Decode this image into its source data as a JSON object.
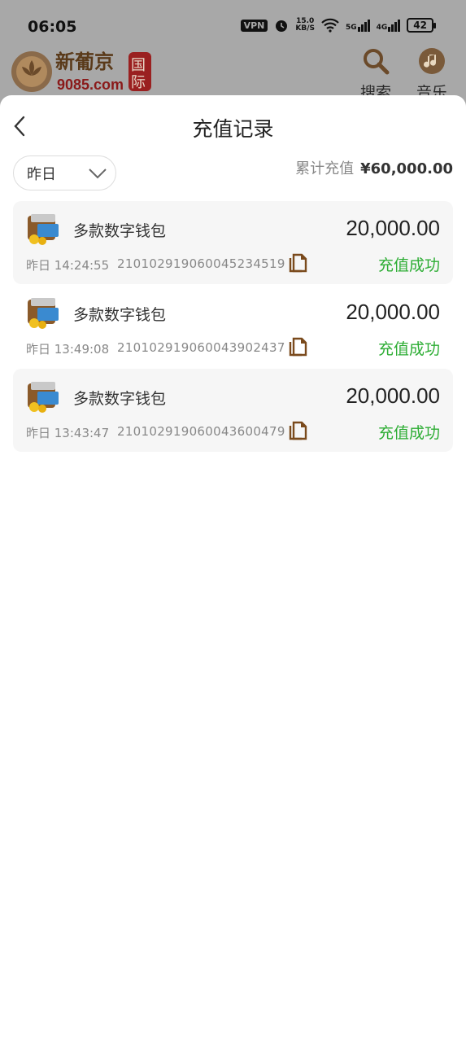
{
  "status_bar": {
    "time": "06:05",
    "vpn": "VPN",
    "speed_value": "15.0",
    "speed_unit": "KB/S",
    "net1": "5G",
    "net2": "4G",
    "battery": "42"
  },
  "app_header": {
    "logo_text": "新葡京国际 9085.com",
    "actions": [
      {
        "label": "搜索",
        "icon": "search-icon"
      },
      {
        "label": "音乐",
        "icon": "music-icon"
      }
    ]
  },
  "sheet": {
    "title": "充值记录",
    "filter": {
      "selected": "昨日"
    },
    "total": {
      "label": "累计充值",
      "amount": "¥60,000.00"
    },
    "records": [
      {
        "name": "多款数字钱包",
        "amount": "20,000.00",
        "date": "昨日 14:24:55",
        "order_id": "210102919060045234519",
        "status": "充值成功"
      },
      {
        "name": "多款数字钱包",
        "amount": "20,000.00",
        "date": "昨日 13:49:08",
        "order_id": "210102919060043902437",
        "status": "充值成功"
      },
      {
        "name": "多款数字钱包",
        "amount": "20,000.00",
        "date": "昨日 13:43:47",
        "order_id": "210102919060043600479",
        "status": "充值成功"
      }
    ]
  },
  "colors": {
    "success": "#2dad34",
    "overlay": "#a8a8a8",
    "icon_brown": "#7a4a1c"
  }
}
